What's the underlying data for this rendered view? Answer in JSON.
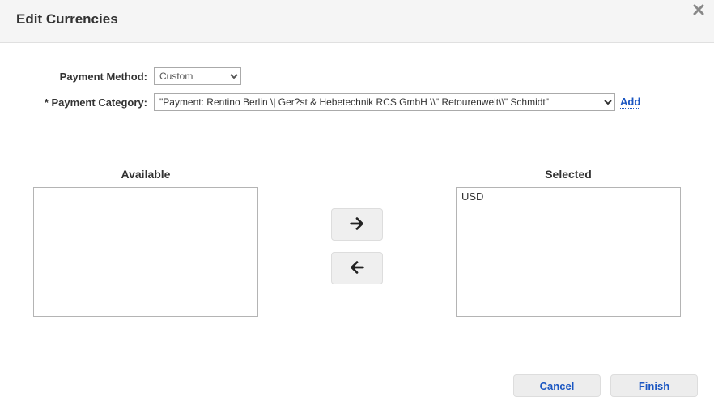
{
  "dialog": {
    "title": "Edit Currencies"
  },
  "form": {
    "paymentMethod": {
      "label": "Payment Method:",
      "value": "Custom"
    },
    "paymentCategory": {
      "labelPrefix": "* ",
      "label": "Payment Category:",
      "value": "\"Payment: Rentino Berlin \\| Ger?st & Hebetechnik RCS GmbH \\\\\" Retourenwelt\\\\\" Schmidt\"",
      "addLabel": "Add"
    }
  },
  "shuttle": {
    "availableHeader": "Available",
    "selectedHeader": "Selected",
    "selectedItems": [
      "USD"
    ]
  },
  "buttons": {
    "cancel": "Cancel",
    "finish": "Finish"
  }
}
